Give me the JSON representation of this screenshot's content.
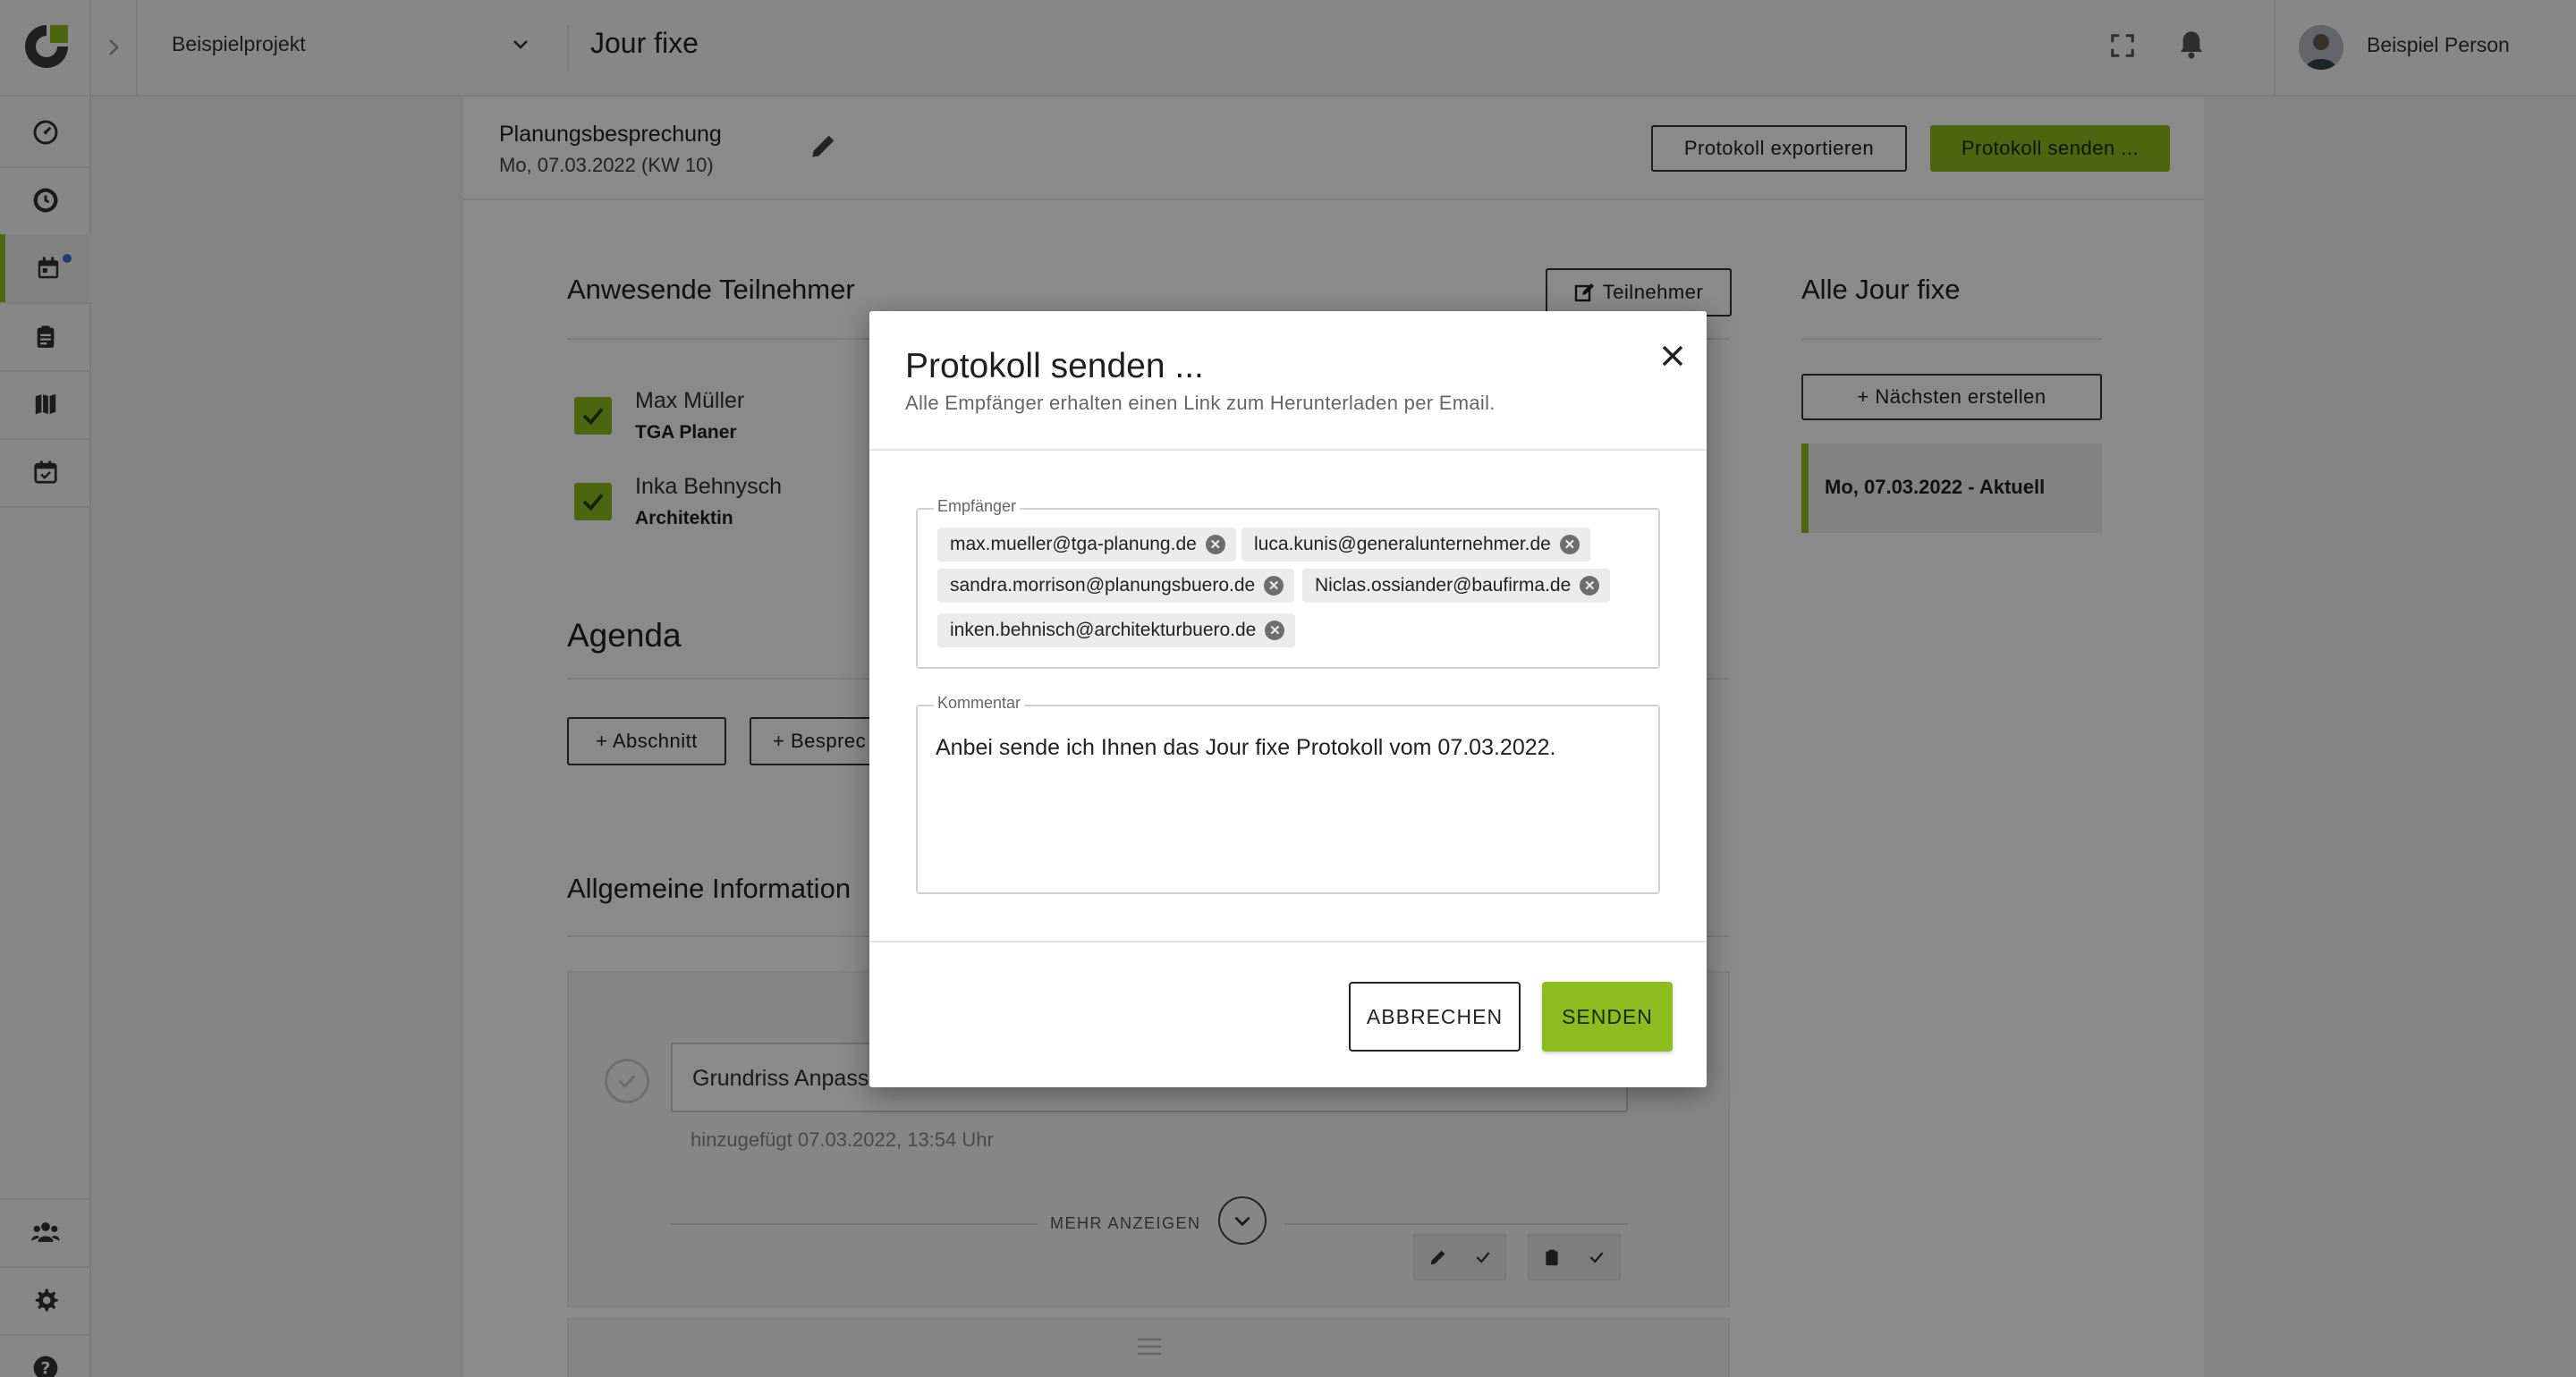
{
  "topbar": {
    "project": "Beispielprojekt",
    "title": "Jour fixe",
    "user_name": "Beispiel Person"
  },
  "sidebar": {
    "items": [
      {
        "icon": "dashboard-icon"
      },
      {
        "icon": "clock-icon"
      },
      {
        "icon": "calendar-icon",
        "active": true
      },
      {
        "icon": "clipboard-icon"
      },
      {
        "icon": "map-icon"
      },
      {
        "icon": "calendar-check-icon"
      },
      {
        "icon": "team-icon"
      },
      {
        "icon": "gear-icon"
      },
      {
        "icon": "help-icon"
      }
    ]
  },
  "meeting": {
    "title": "Planungsbesprechung",
    "date": "Mo, 07.03.2022 (KW 10)",
    "export_label": "Protokoll exportieren",
    "send_label": "Protokoll senden ..."
  },
  "participants": {
    "title": "Anwesende Teilnehmer",
    "edit_label": "Teilnehmer",
    "list": [
      {
        "name": "Max Müller",
        "role": "TGA Planer",
        "checked": true
      },
      {
        "name": "Inka Behnysch",
        "role": "Architektin",
        "checked": true
      }
    ]
  },
  "agenda": {
    "title": "Agenda",
    "add_section_label": "+ Abschnitt",
    "add_discussion_label": "+ Besprec"
  },
  "general_info": {
    "title": "Allgemeine Information",
    "topic_value": "Grundriss Anpass",
    "added_text": "hinzugefügt 07.03.2022, 13:54 Uhr",
    "more_label": "MEHR ANZEIGEN"
  },
  "all_jour_fixe": {
    "title": "Alle Jour fixe",
    "create_next_label": "+ Nächsten erstellen",
    "items": [
      {
        "label": "Mo, 07.03.2022 - Aktuell",
        "active": true
      }
    ]
  },
  "modal": {
    "title": "Protokoll senden ...",
    "subtitle": "Alle Empfänger erhalten einen Link zum Herunterladen per Email.",
    "recipients_label": "Empfänger",
    "recipients": [
      "max.mueller@tga-planung.de",
      "luca.kunis@generalunternehmer.de",
      "sandra.morrison@planungsbuero.de",
      "Niclas.ossiander@baufirma.de",
      "inken.behnisch@architekturbuero.de"
    ],
    "comment_label": "Kommentar",
    "comment_value": "Anbei sende ich Ihnen das Jour fixe Protokoll vom 07.03.2022.",
    "cancel_label": "ABBRECHEN",
    "send_label": "SENDEN"
  },
  "colors": {
    "accent": "#8cbd1e",
    "notification_dot": "#3d6fd6"
  }
}
